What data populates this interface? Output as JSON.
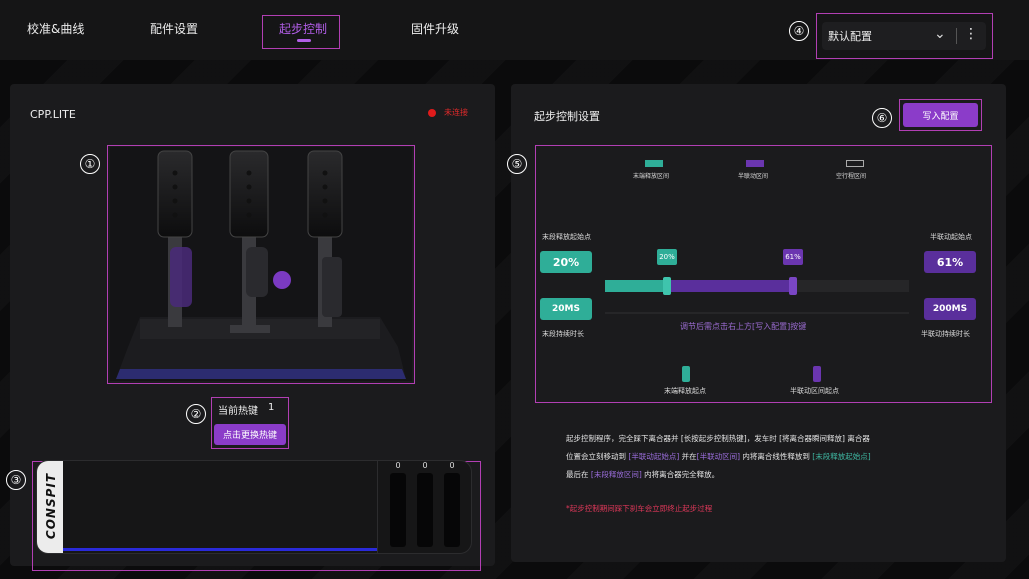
{
  "colors": {
    "accent": "#b25ee8",
    "teal": "#2fae98",
    "purple": "#5a2f9c",
    "callout": "#b23fb4",
    "error": "#e01b1b"
  },
  "nav": {
    "tabs": [
      {
        "label": "校准&曲线",
        "active": false
      },
      {
        "label": "配件设置",
        "active": false
      },
      {
        "label": "起步控制",
        "active": true
      },
      {
        "label": "固件升级",
        "active": false
      }
    ],
    "profile_select": {
      "value": "默认配置",
      "chevron_icon": "chevron-down-icon",
      "more_icon": "more-vertical-icon"
    }
  },
  "callouts": [
    "①",
    "②",
    "③",
    "④",
    "⑤",
    "⑥"
  ],
  "left_panel": {
    "title": "CPP.LITE",
    "status": "未连接",
    "hotkey_label": "当前热键",
    "hotkey_value": "1",
    "change_hotkey_button": "点击更换热键",
    "brand": "CONSPIT",
    "pedal_values": [
      "0",
      "0",
      "0"
    ]
  },
  "right_panel": {
    "title": "起步控制设置",
    "write_button": "写入配置",
    "legend": [
      "末端释放区间",
      "半联动区间",
      "空行程区间"
    ],
    "start_point_label": "末段释放起始点",
    "start_point_value": "20%",
    "duration_label": "末段持续时长",
    "duration_value": "20MS",
    "half_start_label": "半联动起始点",
    "half_start_value": "61%",
    "half_duration_label": "半联动持续时长",
    "half_duration_value": "200MS",
    "tip_left": "20%",
    "tip_right": "61%",
    "slider": {
      "release_end": 0.2,
      "half_end": 0.61
    },
    "hint": "调节后需点击右上方[写入配置]按键",
    "marker_labels": [
      "末端释放起点",
      "半联动区间起点"
    ]
  },
  "description": {
    "line1_a": "起步控制程序，完全踩下离合器并 [长按起步控制热键]，发车时 [将离合器瞬间释放] 离合器",
    "line2_a": "位置会立刻移动到 ",
    "line2_b": "[半联动起始点]",
    "line2_c": " 并在",
    "line2_d": "[半联动区间]",
    "line2_e": " 内将离合线性释放到 ",
    "line2_f": "[末段释放起始点]",
    "line3_a": "最后在 ",
    "line3_b": "[末段释放区间]",
    "line3_c": " 内将离合器完全释放。",
    "warning": "*起步控制期间踩下刹车会立即终止起步过程"
  }
}
